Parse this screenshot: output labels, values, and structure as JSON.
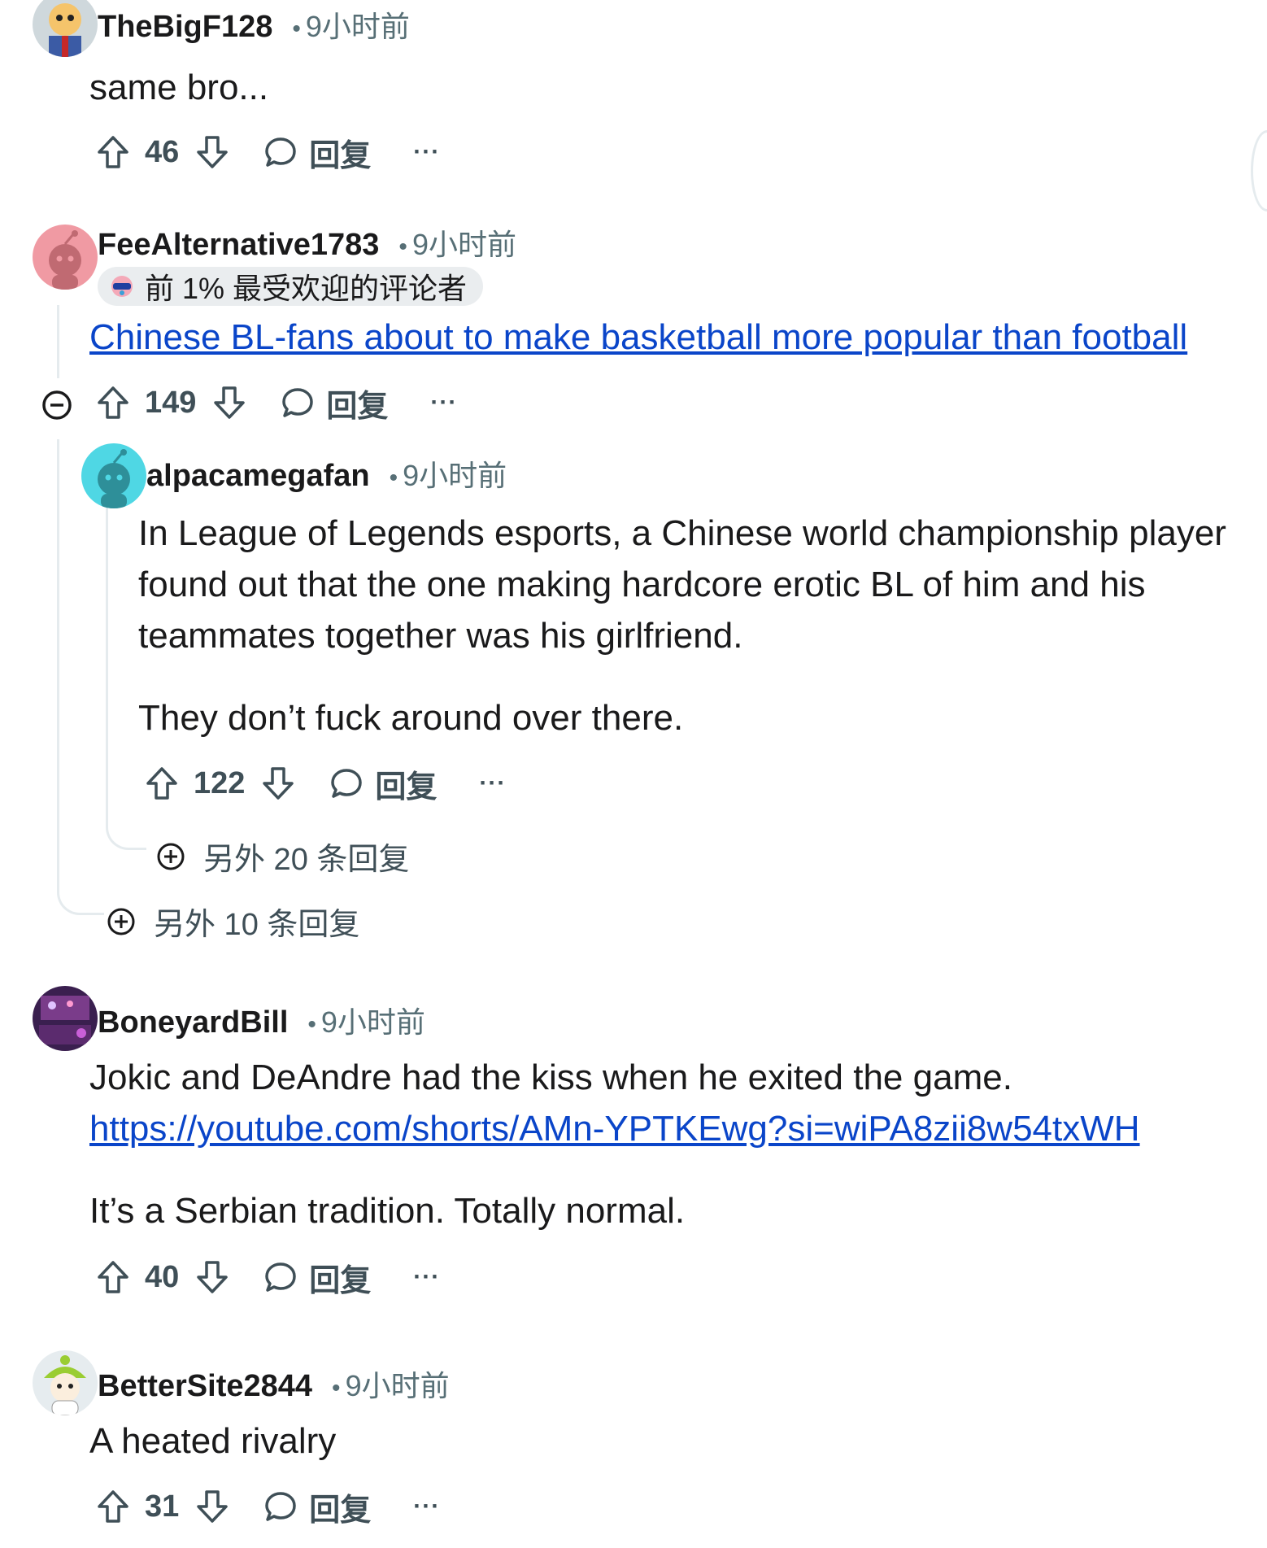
{
  "comments": {
    "c1": {
      "username": "TheBigF128",
      "time": "9小时前",
      "body": "same bro...",
      "score": "46",
      "reply_label": "回复",
      "more_label": "···"
    },
    "c2": {
      "username": "FeeAlternative1783",
      "time": "9小时前",
      "flair": "前 1% 最受欢迎的评论者",
      "link_text": "Chinese BL-fans about to make basketball more popular than football",
      "score": "149",
      "reply_label": "回复",
      "more_label": "···",
      "more_replies": "另外 10 条回复"
    },
    "c3": {
      "username": "alpacamegafan",
      "time": "9小时前",
      "body_lines": [
        "In League of Legends esports, a Chinese world championship player",
        "found out that the one making hardcore erotic BL of him and his",
        "teammates together was his girlfriend."
      ],
      "body_para2": "They don’t fuck around over there.",
      "score": "122",
      "reply_label": "回复",
      "more_label": "···",
      "more_replies": "另外 20 条回复"
    },
    "c4": {
      "username": "BoneyardBill",
      "time": "9小时前",
      "body_line1": "Jokic and DeAndre had the kiss when he exited the game.",
      "link_text": "https://youtube.com/shorts/AMn-YPTKEwg?si=wiPA8zii8w54txWH",
      "body_para2": "It’s a Serbian tradition. Totally normal.",
      "score": "40",
      "reply_label": "回复",
      "more_label": "···"
    },
    "c5": {
      "username": "BetterSite2844",
      "time": "9小时前",
      "body": "A heated rivalry",
      "score": "31",
      "reply_label": "回复",
      "more_label": "···"
    }
  },
  "icons": {
    "upvote": "arrow-up-icon",
    "downvote": "arrow-down-icon",
    "reply": "speech-bubble-icon",
    "collapse": "minus-circle-icon",
    "expand": "plus-circle-icon",
    "flair": "top-commenter-badge-icon"
  },
  "colors": {
    "link": "#0a45c9",
    "meta": "#576f76",
    "action": "#3f4f57",
    "thread": "#e5ebee",
    "flair_bg": "#eaedef"
  }
}
